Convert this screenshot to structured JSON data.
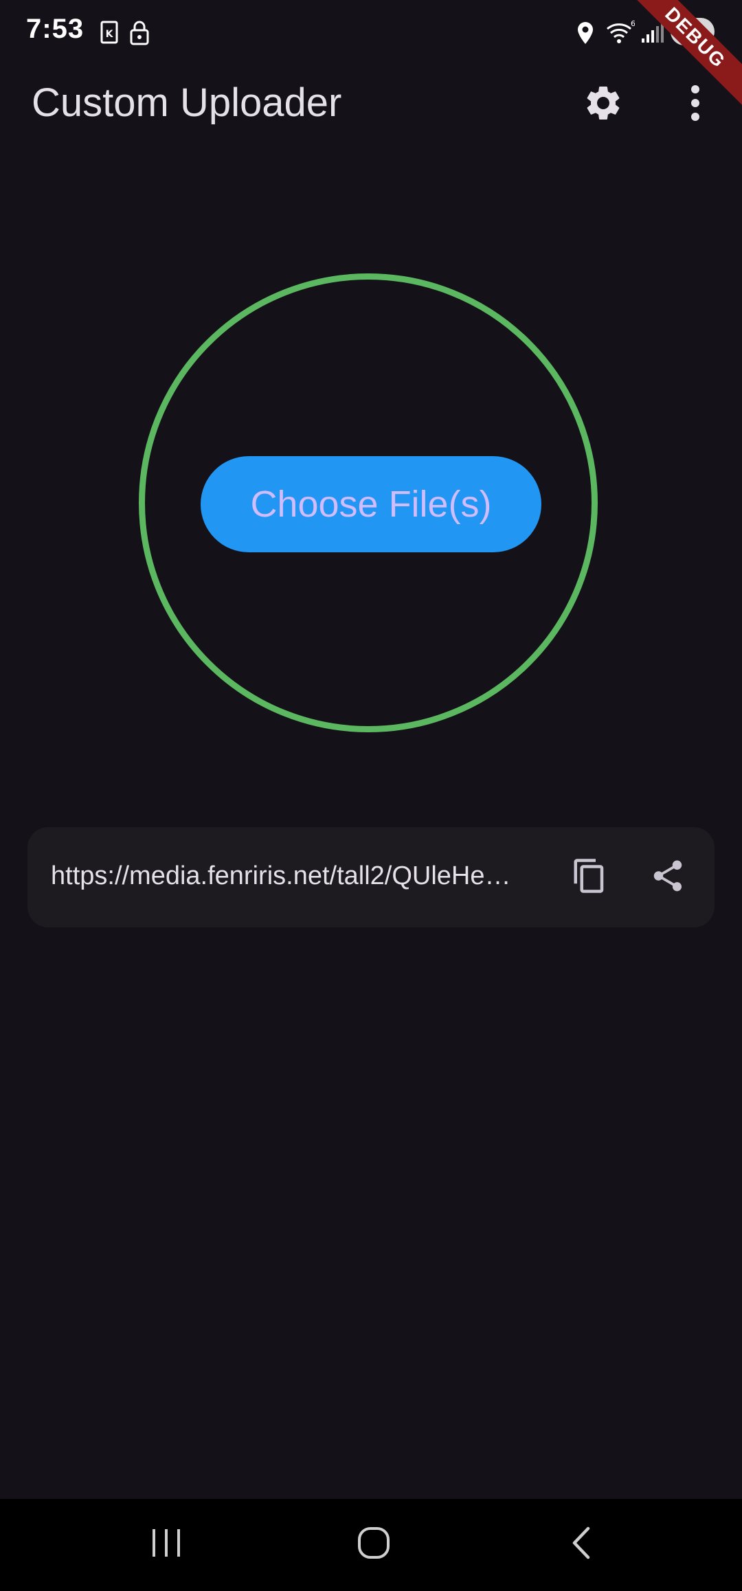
{
  "status_bar": {
    "time": "7:53",
    "battery": "88",
    "icons": [
      "sim-card-icon",
      "lock-icon",
      "location-icon",
      "wifi-icon",
      "signal-icon",
      "battery-icon"
    ]
  },
  "debug_banner": {
    "label": "DEBUG"
  },
  "app_bar": {
    "title": "Custom Uploader",
    "actions": [
      "settings-icon",
      "more-vert-icon"
    ]
  },
  "upload": {
    "button_label": "Choose File(s)",
    "ring_color": "#5cb860",
    "button_color": "#2196f3",
    "button_text_color": "#d0bcff"
  },
  "result": {
    "url": "https://media.fenriris.net/tall2/QUleHe…",
    "actions": [
      "copy-icon",
      "share-icon"
    ]
  },
  "navigation": {
    "buttons": [
      "recent-apps-icon",
      "home-icon",
      "back-icon"
    ]
  },
  "theme": {
    "background": "#141218",
    "surface": "#1d1b20",
    "text": "#e6e0e9"
  }
}
